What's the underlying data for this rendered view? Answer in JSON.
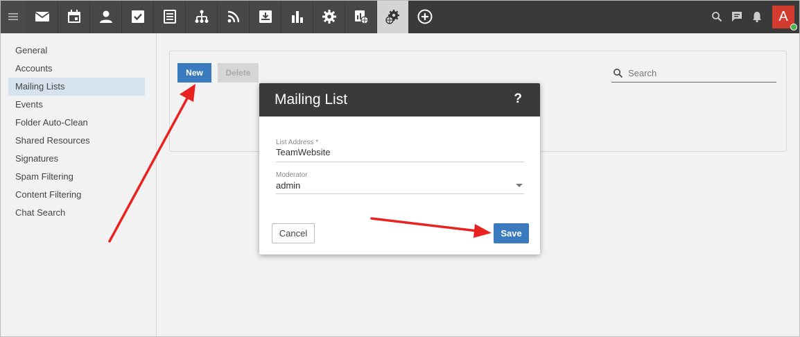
{
  "topbar": {
    "apps": [
      {
        "icon": "mail-icon"
      },
      {
        "icon": "calendar-icon"
      },
      {
        "icon": "contacts-icon"
      },
      {
        "icon": "tasks-icon"
      },
      {
        "icon": "notes-icon"
      },
      {
        "icon": "sitemap-icon"
      },
      {
        "icon": "rss-icon"
      },
      {
        "icon": "download-box-icon"
      },
      {
        "icon": "bar-chart-icon"
      },
      {
        "icon": "gear-icon"
      },
      {
        "icon": "report-globe-icon"
      },
      {
        "icon": "globe-gear-icon",
        "active": true
      },
      {
        "icon": "add-circle-icon"
      }
    ],
    "right_icons": [
      "search-icon",
      "chat-icon",
      "bell-icon"
    ],
    "avatar_letter": "A",
    "avatar_color": "#d23b30"
  },
  "sidebar": {
    "items": [
      {
        "label": "General"
      },
      {
        "label": "Accounts"
      },
      {
        "label": "Mailing Lists",
        "active": true
      },
      {
        "label": "Events"
      },
      {
        "label": "Folder Auto-Clean"
      },
      {
        "label": "Shared Resources"
      },
      {
        "label": "Signatures"
      },
      {
        "label": "Spam Filtering"
      },
      {
        "label": "Content Filtering"
      },
      {
        "label": "Chat Search"
      }
    ]
  },
  "toolbar": {
    "new_label": "New",
    "delete_label": "Delete",
    "search_placeholder": "Search"
  },
  "dialog": {
    "title": "Mailing List",
    "help": "?",
    "list_address_label": "List Address *",
    "list_address_value": "TeamWebsite",
    "moderator_label": "Moderator",
    "moderator_value": "admin",
    "cancel_label": "Cancel",
    "save_label": "Save"
  },
  "colors": {
    "primary_button": "#3a7bbf",
    "topbar": "#3a3a3a",
    "annotation_arrow": "#e8231f"
  }
}
